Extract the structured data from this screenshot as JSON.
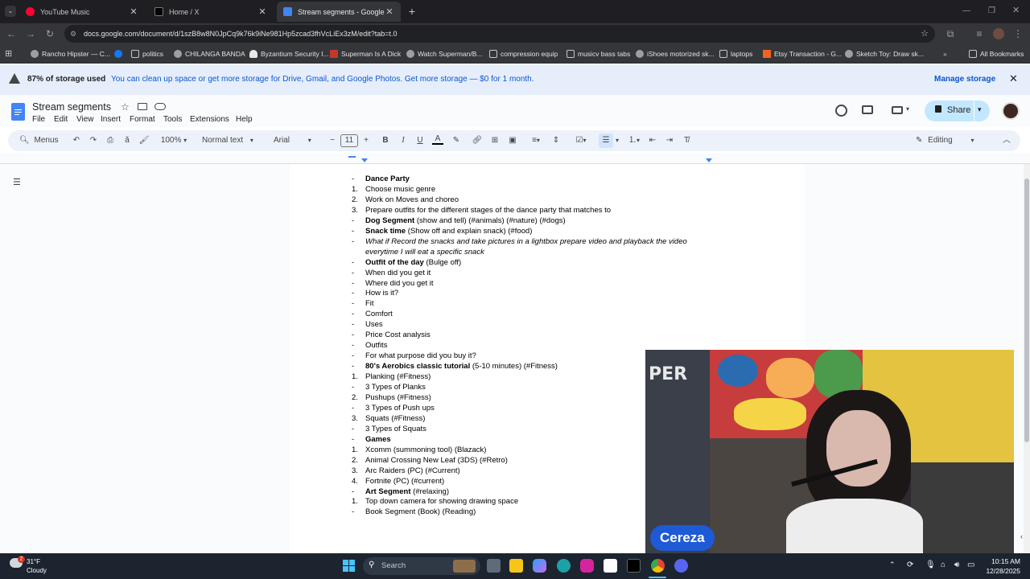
{
  "browser": {
    "tabs": [
      {
        "label": "YouTube Music",
        "favicon_color": "#ff0033",
        "active": false
      },
      {
        "label": "Home / X",
        "favicon_color": "#000000",
        "active": false
      },
      {
        "label": "Stream segments - Google Do",
        "favicon_color": "#4285f4",
        "active": true
      }
    ],
    "new_tab": "+",
    "url": "docs.google.com/document/d/1szB8w8N0JpCq9k76k9iNe981Hp5zcad3fhVcLiEx3zM/edit?tab=t.0",
    "bookmarks": [
      {
        "label": "Rancho Hipster — C...",
        "icon": "globe-icon",
        "color": "#9aa0a6"
      },
      {
        "label": "",
        "icon": "facebook-icon",
        "color": "#1877f2"
      },
      {
        "label": "politics",
        "icon": "folder-icon",
        "color": "#c7c7c7"
      },
      {
        "label": "CHILANGA BANDA",
        "icon": "globe-icon",
        "color": "#9aa0a6"
      },
      {
        "label": "Byzantium Security I...",
        "icon": "bell-icon",
        "color": "#e8e8e8"
      },
      {
        "label": "Superman Is A Dick",
        "icon": "video-icon",
        "color": "#c0392b"
      },
      {
        "label": "Watch Superman/B...",
        "icon": "globe-icon",
        "color": "#9aa0a6"
      },
      {
        "label": "compression equip",
        "icon": "folder-icon",
        "color": "#c7c7c7"
      },
      {
        "label": "musicv bass tabs",
        "icon": "folder-icon",
        "color": "#c7c7c7"
      },
      {
        "label": "iShoes motorized sk...",
        "icon": "globe-icon",
        "color": "#9aa0a6"
      },
      {
        "label": "laptops",
        "icon": "folder-icon",
        "color": "#c7c7c7"
      },
      {
        "label": "Etsy Transaction - G...",
        "icon": "etsy-icon",
        "color": "#f1641e"
      },
      {
        "label": "Sketch Toy: Draw sk...",
        "icon": "globe-icon",
        "color": "#9aa0a6"
      }
    ],
    "all_bookmarks": "All Bookmarks"
  },
  "banner": {
    "bold": "87% of storage used",
    "text": "You can clean up space or get more storage for Drive, Gmail, and Google Photos. Get more storage — $0 for 1 month.",
    "action": "Manage storage"
  },
  "doc": {
    "title": "Stream segments",
    "menus": [
      "File",
      "Edit",
      "View",
      "Insert",
      "Format",
      "Tools",
      "Extensions",
      "Help"
    ],
    "share": "Share",
    "toolbar": {
      "menus_search": "Menus",
      "zoom": "100%",
      "style": "Normal text",
      "font": "Arial",
      "font_size": "11",
      "mode": "Editing"
    },
    "lines": [
      {
        "m": "-",
        "parts": [
          {
            "t": "Dance Party",
            "s": "b"
          }
        ]
      },
      {
        "m": "1.",
        "parts": [
          {
            "t": "Choose music genre",
            "s": ""
          }
        ]
      },
      {
        "m": "2.",
        "parts": [
          {
            "t": "Work on Moves and choreo",
            "s": ""
          }
        ]
      },
      {
        "m": "3.",
        "parts": [
          {
            "t": "Prepare outfits for the different stages of the dance party that matches to",
            "s": ""
          }
        ]
      },
      {
        "m": "-",
        "parts": [
          {
            "t": "Dog Segment",
            "s": "b"
          },
          {
            "t": " (show and tell) (#animals) (#nature) (#dogs)",
            "s": ""
          }
        ]
      },
      {
        "m": "-",
        "parts": [
          {
            "t": "Snack time",
            "s": "b"
          },
          {
            "t": " (Show off and explain snack) (#food)",
            "s": ""
          }
        ]
      },
      {
        "m": "-",
        "parts": [
          {
            "t": "What if Record the snacks and take pictures in a lightbox prepare video and playback the video",
            "s": "i"
          }
        ]
      },
      {
        "m": "",
        "parts": [
          {
            "t": "everytime I will eat a specific snack",
            "s": "i"
          }
        ]
      },
      {
        "m": "-",
        "parts": [
          {
            "t": "Outfit of the day",
            "s": "b"
          },
          {
            "t": " (Bulge off)",
            "s": ""
          }
        ]
      },
      {
        "m": "-",
        "parts": [
          {
            "t": "When did you get it",
            "s": ""
          }
        ]
      },
      {
        "m": "-",
        "parts": [
          {
            "t": "Where did you get it",
            "s": ""
          }
        ]
      },
      {
        "m": "-",
        "parts": [
          {
            "t": "How is it?",
            "s": ""
          }
        ]
      },
      {
        "m": "-",
        "parts": [
          {
            "t": "Fit",
            "s": ""
          }
        ]
      },
      {
        "m": "-",
        "parts": [
          {
            "t": "Comfort",
            "s": ""
          }
        ]
      },
      {
        "m": "-",
        "parts": [
          {
            "t": "Uses",
            "s": ""
          }
        ]
      },
      {
        "m": "-",
        "parts": [
          {
            "t": "Price Cost analysis",
            "s": ""
          }
        ]
      },
      {
        "m": "-",
        "parts": [
          {
            "t": "Outfits",
            "s": ""
          }
        ]
      },
      {
        "m": "-",
        "parts": [
          {
            "t": "For what purpose did you buy it?",
            "s": ""
          }
        ]
      },
      {
        "m": "-",
        "parts": [
          {
            "t": "80's Aerobics classic tutorial",
            "s": "b"
          },
          {
            "t": " (5-10 minutes) (#Fitness)",
            "s": ""
          }
        ]
      },
      {
        "m": "1.",
        "parts": [
          {
            "t": "Planking (#Fitness)",
            "s": ""
          }
        ]
      },
      {
        "m": "-",
        "parts": [
          {
            "t": "3 Types of Planks",
            "s": ""
          }
        ]
      },
      {
        "m": "2.",
        "parts": [
          {
            "t": "Pushups (#Fitness)",
            "s": ""
          }
        ]
      },
      {
        "m": "-",
        "parts": [
          {
            "t": "3 Types of Push ups",
            "s": ""
          }
        ]
      },
      {
        "m": "3.",
        "parts": [
          {
            "t": "Squats (#Fitness)",
            "s": ""
          }
        ]
      },
      {
        "m": "-",
        "parts": [
          {
            "t": "3 Types of Squats",
            "s": ""
          }
        ]
      },
      {
        "m": "-",
        "parts": [
          {
            "t": "Games",
            "s": "b"
          }
        ]
      },
      {
        "m": "1.",
        "parts": [
          {
            "t": "Xcomm (summoning tool) (Blazack)",
            "s": ""
          }
        ]
      },
      {
        "m": "2.",
        "parts": [
          {
            "t": "Animal Crossing New Leaf (3DS) (#Retro)",
            "s": ""
          }
        ]
      },
      {
        "m": "3.",
        "parts": [
          {
            "t": "Arc Raiders (PC) (#Current)",
            "s": ""
          }
        ]
      },
      {
        "m": "4.",
        "parts": [
          {
            "t": "Fortnite (PC) (#current)",
            "s": ""
          }
        ]
      },
      {
        "m": "-",
        "parts": [
          {
            "t": "Art Segment",
            "s": "b"
          },
          {
            "t": " (#relaxing)",
            "s": ""
          }
        ]
      },
      {
        "m": "1.",
        "parts": [
          {
            "t": "Top down camera for showing drawing space",
            "s": ""
          }
        ]
      },
      {
        "m": "-",
        "parts": [
          {
            "t": "Book Segment (Book) (Reading)",
            "s": ""
          }
        ]
      }
    ]
  },
  "webcam": {
    "name": "Cereza",
    "badge_color": "#1e5ad6",
    "poster_text": "PER"
  },
  "taskbar": {
    "weather_temp": "31°F",
    "weather_desc": "Cloudy",
    "weather_badge": "2",
    "search": "Search",
    "time": "10:15 AM",
    "date": "12/28/2025",
    "apps": [
      "file-explorer-icon",
      "copilot-icon",
      "edge-icon",
      "instagram-icon",
      "amazon-icon",
      "x-icon",
      "chrome-icon",
      "discord-icon"
    ]
  },
  "colors": {
    "accent": "#0b57d0",
    "share_bg": "#c2e7ff",
    "banner_bg": "#e6eefc"
  }
}
